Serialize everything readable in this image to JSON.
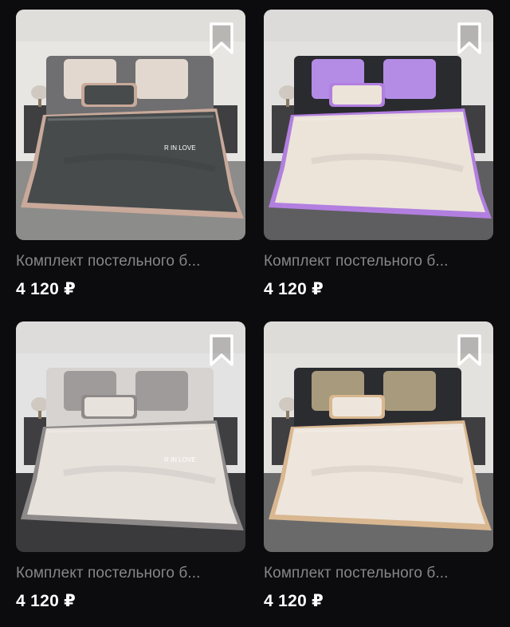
{
  "products": [
    {
      "title": "Комплект постельного б...",
      "price": "4 120 ₽",
      "bookmark_icon": "bookmark-icon",
      "embroidery": "R IN LOVE",
      "colors": {
        "wall": "#e8e6e3",
        "floor": "#8c8c8a",
        "headboard": "#6f6e70",
        "duvet": "#474b4c",
        "trim": "#c8a99a",
        "pillow_back": "#e2d8cf"
      }
    },
    {
      "title": "Комплект постельного б...",
      "price": "4 120 ₽",
      "bookmark_icon": "bookmark-icon",
      "embroidery": "",
      "colors": {
        "wall": "#e3e1df",
        "floor": "#5e5e60",
        "headboard": "#2a2b2e",
        "duvet": "#ece4d9",
        "trim": "#b27fe0",
        "pillow_back": "#b48ce6"
      }
    },
    {
      "title": "Комплект постельного б...",
      "price": "4 120 ₽",
      "bookmark_icon": "bookmark-icon",
      "embroidery": "R IN LOVE",
      "colors": {
        "wall": "#e3e3e3",
        "floor": "#3a3a3c",
        "headboard": "#d6d3d0",
        "duvet": "#e8e2dd",
        "trim": "#8d8a89",
        "pillow_back": "#9e9b9a"
      }
    },
    {
      "title": "Комплект постельного б...",
      "price": "4 120 ₽",
      "bookmark_icon": "bookmark-icon",
      "embroidery": "",
      "colors": {
        "wall": "#e4e2de",
        "floor": "#6a6a6b",
        "headboard": "#2b2c30",
        "duvet": "#eee6dc",
        "trim": "#d9b790",
        "pillow_back": "#a89a7c"
      }
    }
  ]
}
